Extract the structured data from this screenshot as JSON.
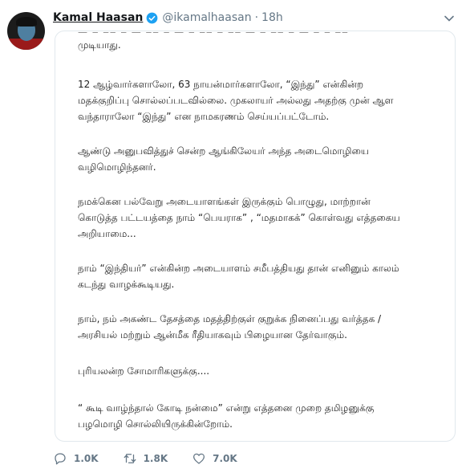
{
  "author": {
    "name": "Kamal Haasan",
    "handle": "@ikamalhaasan",
    "separator": "·",
    "time": "18h"
  },
  "icons": {
    "verified": "verified-badge-icon",
    "menu": "chevron-down-icon",
    "reply": "reply-icon",
    "retweet": "retweet-icon",
    "like": "heart-icon"
  },
  "colors": {
    "verified": "#1da1f2",
    "muted": "#657786",
    "border": "#e1e8ed"
  },
  "tweet_body": {
    "paragraphs": [
      "முடியாது.",
      "12 ஆழ்வார்களாலோ, 63 நாயன்மார்களாலோ, “இந்து”  என்கின்ற\nமதக்குறிப்பு சொல்லப்படவில்லை. முகலாயர் அல்லது அதற்கு முன் ஆள\nவந்தாராலோ “இந்து”  என நாமகரணம் செய்யப்பட்டோம்.",
      "ஆண்டு அனுபவித்துச் சென்ற ஆங்கிலேயர் அந்த அடைமொழியை\nவழிமொழிந்தனர்.",
      "நமக்கென பல்வேறு அடையாளங்கள் இருக்கும் பொழுது, மாற்றான்\nகொடுத்த பட்டயத்தை நாம் “பெயராக” , “மதமாகக்”  கொள்வது எத்தகைய\nஅறியாமை...",
      "நாம் “இந்தியர்”  என்கின்ற அடையாளம் சமீபத்தியது தான் எனினும் காலம்\nகடந்து வாழக்கூடியது.",
      "நாம், நம் அகண்ட தேசத்தை மதத்திற்குள் குறுக்க நினைப்பது வர்த்தக /\nஅரசியல் மற்றும் ஆன்மீக ரீதியாகவும் பிழையான தேர்வாகும்.",
      "புரியலன்ற சோமாரிகளுக்கு....",
      " “ கூடி வாழ்ந்தால் கோடி நன்மை”  என்று எத்தனை முறை தமிழனுக்கு\nபழமொழி சொல்லியிருக்கின்றோம்."
    ]
  },
  "actions": {
    "replies": "1.0K",
    "retweets": "1.8K",
    "likes": "7.0K"
  }
}
